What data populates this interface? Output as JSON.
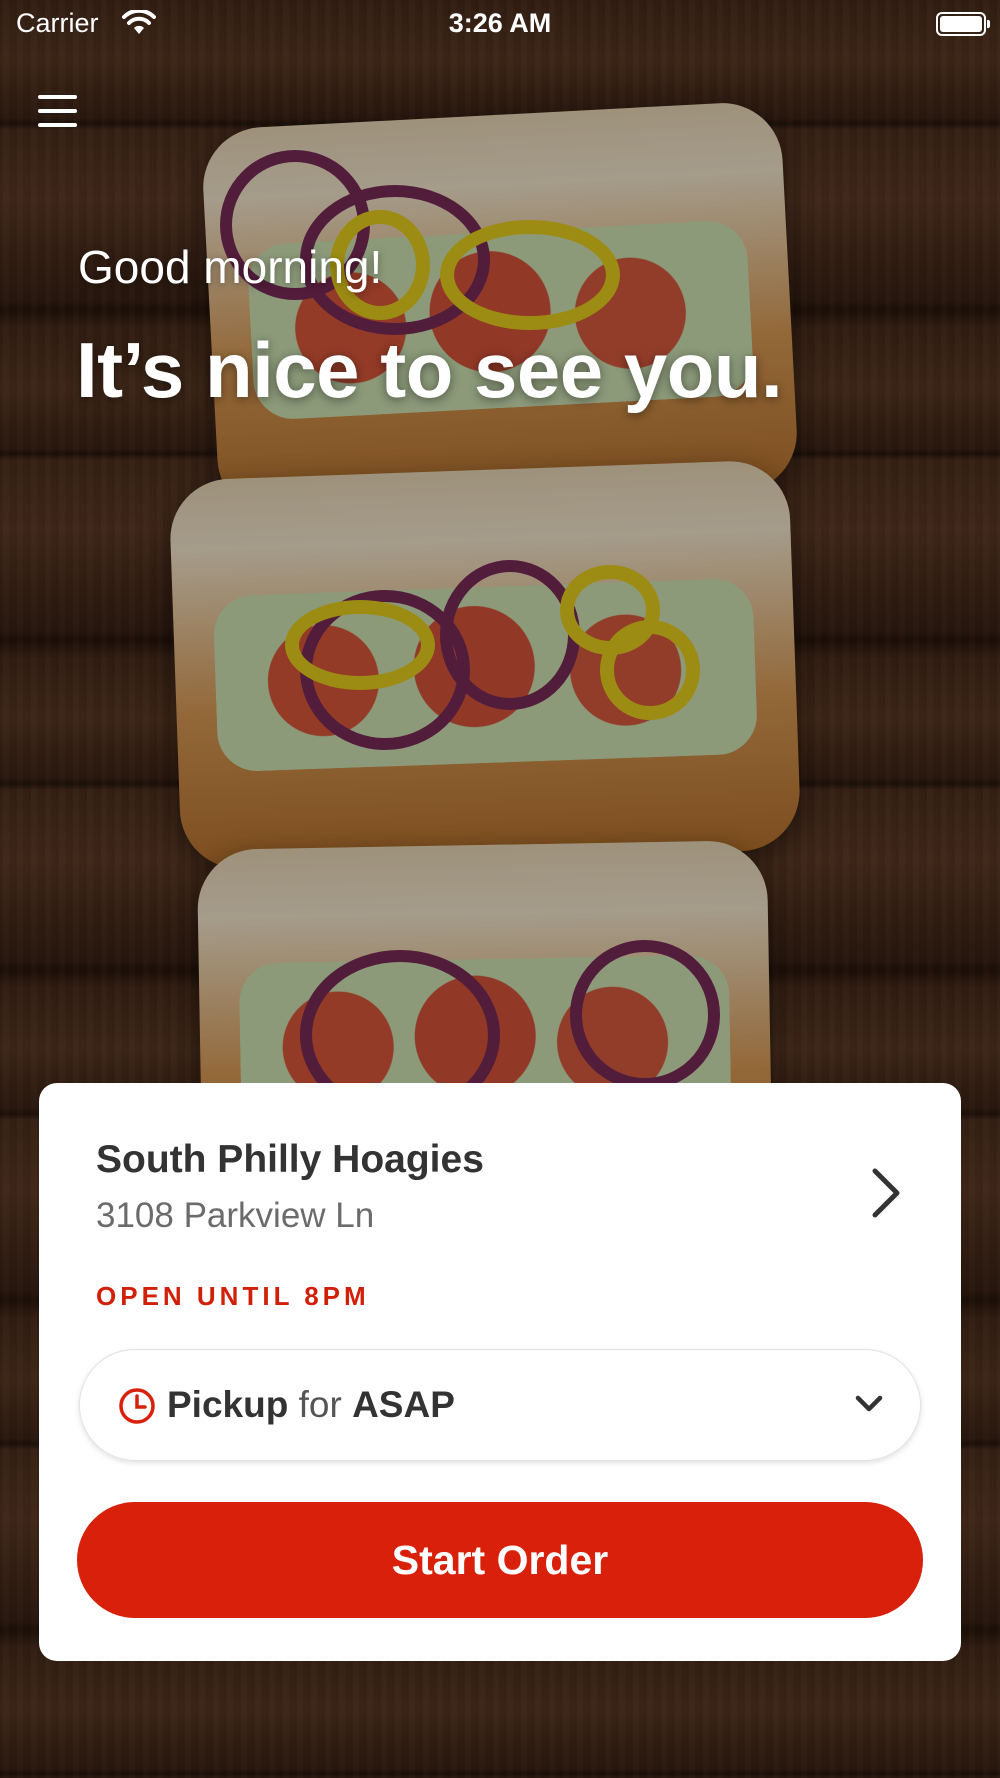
{
  "status_bar": {
    "carrier": "Carrier",
    "time": "3:26 AM"
  },
  "header": {
    "menu_icon": "hamburger-menu-icon"
  },
  "hero": {
    "greeting": "Good morning!",
    "headline": "It’s nice to see you."
  },
  "store": {
    "name": "South Philly Hoagies",
    "address": "3108 Parkview Ln",
    "hours": "OPEN UNTIL 8PM"
  },
  "order_mode": {
    "type": "Pickup",
    "connector": "for",
    "time": "ASAP"
  },
  "cta": {
    "label": "Start Order"
  },
  "colors": {
    "brand_red": "#d9200a",
    "text_dark": "#333333",
    "text_muted": "#6b6b6b"
  }
}
